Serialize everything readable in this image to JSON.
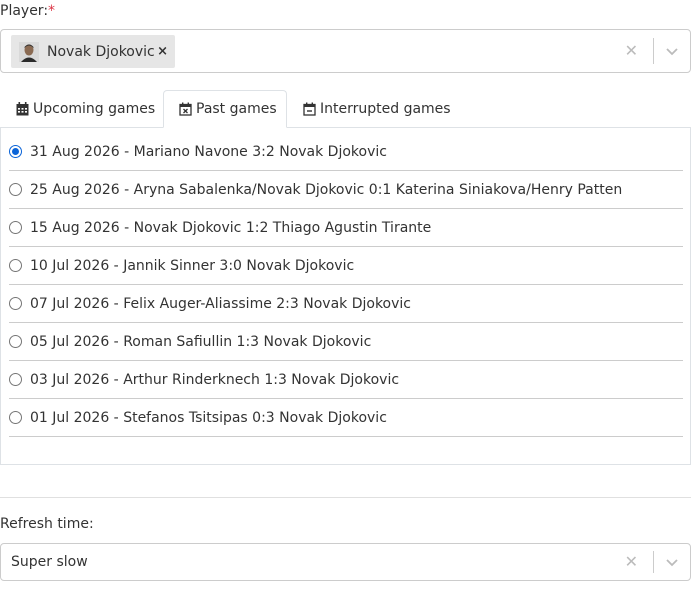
{
  "player_field": {
    "label": "Player:",
    "required_mark": "*",
    "selected_chip": {
      "label": "Novak Djokovic",
      "remove_glyph": "×"
    },
    "clear_glyph": "✕"
  },
  "tabs": [
    {
      "label": "Upcoming games",
      "icon": "calendar-icon",
      "active": false
    },
    {
      "label": "Past games",
      "icon": "calendar-x-icon",
      "active": true
    },
    {
      "label": "Interrupted games",
      "icon": "calendar-minus-icon",
      "active": false
    }
  ],
  "games": [
    {
      "label": "31 Aug 2026 - Mariano Navone 3:2 Novak Djokovic",
      "selected": true
    },
    {
      "label": "25 Aug 2026 - Aryna Sabalenka/Novak Djokovic 0:1 Katerina Siniakova/Henry Patten",
      "selected": false
    },
    {
      "label": "15 Aug 2026 - Novak Djokovic 1:2 Thiago Agustin Tirante",
      "selected": false
    },
    {
      "label": "10 Jul 2026 - Jannik Sinner 3:0 Novak Djokovic",
      "selected": false
    },
    {
      "label": "07 Jul 2026 - Felix Auger-Aliassime 2:3 Novak Djokovic",
      "selected": false
    },
    {
      "label": "05 Jul 2026 - Roman Safiullin 1:3 Novak Djokovic",
      "selected": false
    },
    {
      "label": "03 Jul 2026 - Arthur Rinderknech 1:3 Novak Djokovic",
      "selected": false
    },
    {
      "label": "01 Jul 2026 - Stefanos Tsitsipas 0:3 Novak Djokovic",
      "selected": false
    }
  ],
  "refresh_field": {
    "label": "Refresh time:",
    "value": "Super slow",
    "clear_glyph": "✕"
  },
  "colors": {
    "accent": "#0b64d8",
    "required": "#dc3545",
    "border": "#cccccc"
  }
}
